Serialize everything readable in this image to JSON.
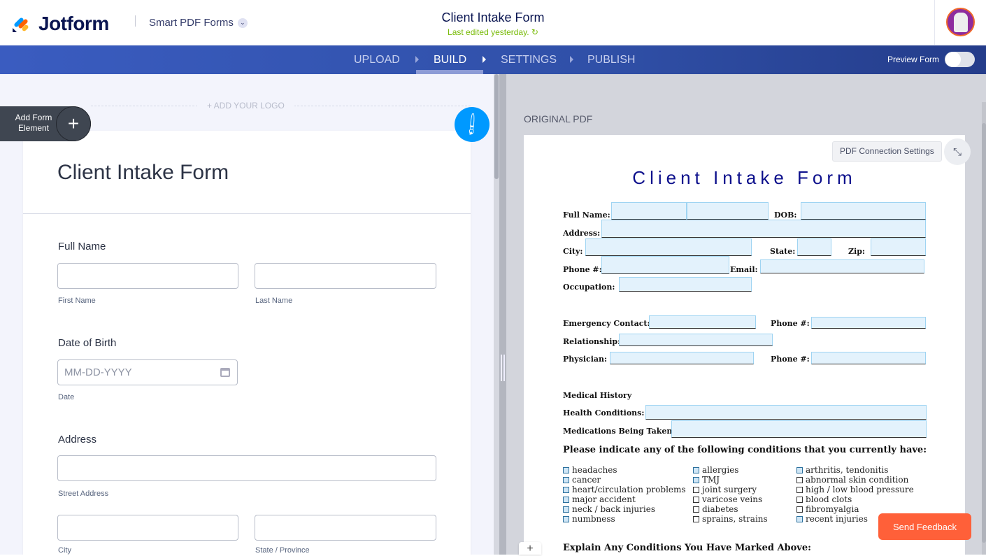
{
  "header": {
    "brand": "Jotform",
    "product": "Smart PDF Forms",
    "form_title": "Client Intake Form",
    "last_edited": "Last edited yesterday."
  },
  "nav": {
    "tabs": [
      "UPLOAD",
      "BUILD",
      "SETTINGS",
      "PUBLISH"
    ],
    "active": "BUILD",
    "preview_label": "Preview Form",
    "preview_on": false
  },
  "builder": {
    "add_logo": "+ ADD YOUR LOGO",
    "add_element": "Add Form Element",
    "form_title": "Client Intake Form",
    "full_name": {
      "label": "Full Name",
      "first": "First Name",
      "last": "Last Name"
    },
    "dob": {
      "label": "Date of Birth",
      "placeholder": "MM-DD-YYYY",
      "sub": "Date"
    },
    "address": {
      "label": "Address",
      "street": "Street Address",
      "city": "City",
      "state": "State / Province"
    }
  },
  "pdf": {
    "section_label": "ORIGINAL PDF",
    "connection_settings": "PDF Connection Settings",
    "title": "Client Intake Form",
    "labels": {
      "full_name": "Full Name:",
      "dob": "DOB:",
      "address": "Address:",
      "city": "City:",
      "state": "State:",
      "zip": "Zip:",
      "phone": "Phone #:",
      "email": "Email:",
      "occupation": "Occupation:",
      "emergency": "Emergency Contact:",
      "phone2": "Phone #:",
      "relationship": "Relationship:",
      "physician": "Physician:",
      "phone3": "Phone #:",
      "medical_history": "Medical History",
      "health": "Health Conditions:",
      "medications": "Medications Being Taken:",
      "indicate": "Please indicate any of the following conditions that you currently have:",
      "explain": "Explain Any Conditions You Have Marked Above:"
    },
    "conditions": [
      [
        {
          "t": "headaches",
          "f": true
        },
        {
          "t": "cancer",
          "f": true
        },
        {
          "t": "heart/circulation problems",
          "f": true
        },
        {
          "t": "major accident",
          "f": true
        },
        {
          "t": "neck / back injuries",
          "f": true
        },
        {
          "t": "numbness",
          "f": true
        }
      ],
      [
        {
          "t": "allergies",
          "f": true
        },
        {
          "t": "TMJ",
          "f": true
        },
        {
          "t": "joint surgery",
          "f": false
        },
        {
          "t": "varicose veins",
          "f": false
        },
        {
          "t": "diabetes",
          "f": false
        },
        {
          "t": "sprains, strains",
          "f": false
        }
      ],
      [
        {
          "t": "arthritis, tendonitis",
          "f": true
        },
        {
          "t": "abnormal skin condition",
          "f": false
        },
        {
          "t": "high / low blood pressure",
          "f": false
        },
        {
          "t": "blood clots",
          "f": false
        },
        {
          "t": "fibromyalgia",
          "f": false
        },
        {
          "t": "recent injuries",
          "f": true
        }
      ]
    ]
  },
  "feedback": "Send Feedback",
  "colors": {
    "nav": "#3050a8",
    "accent": "#0099ff",
    "feedback": "#ff6039",
    "edited": "#78bb07"
  }
}
